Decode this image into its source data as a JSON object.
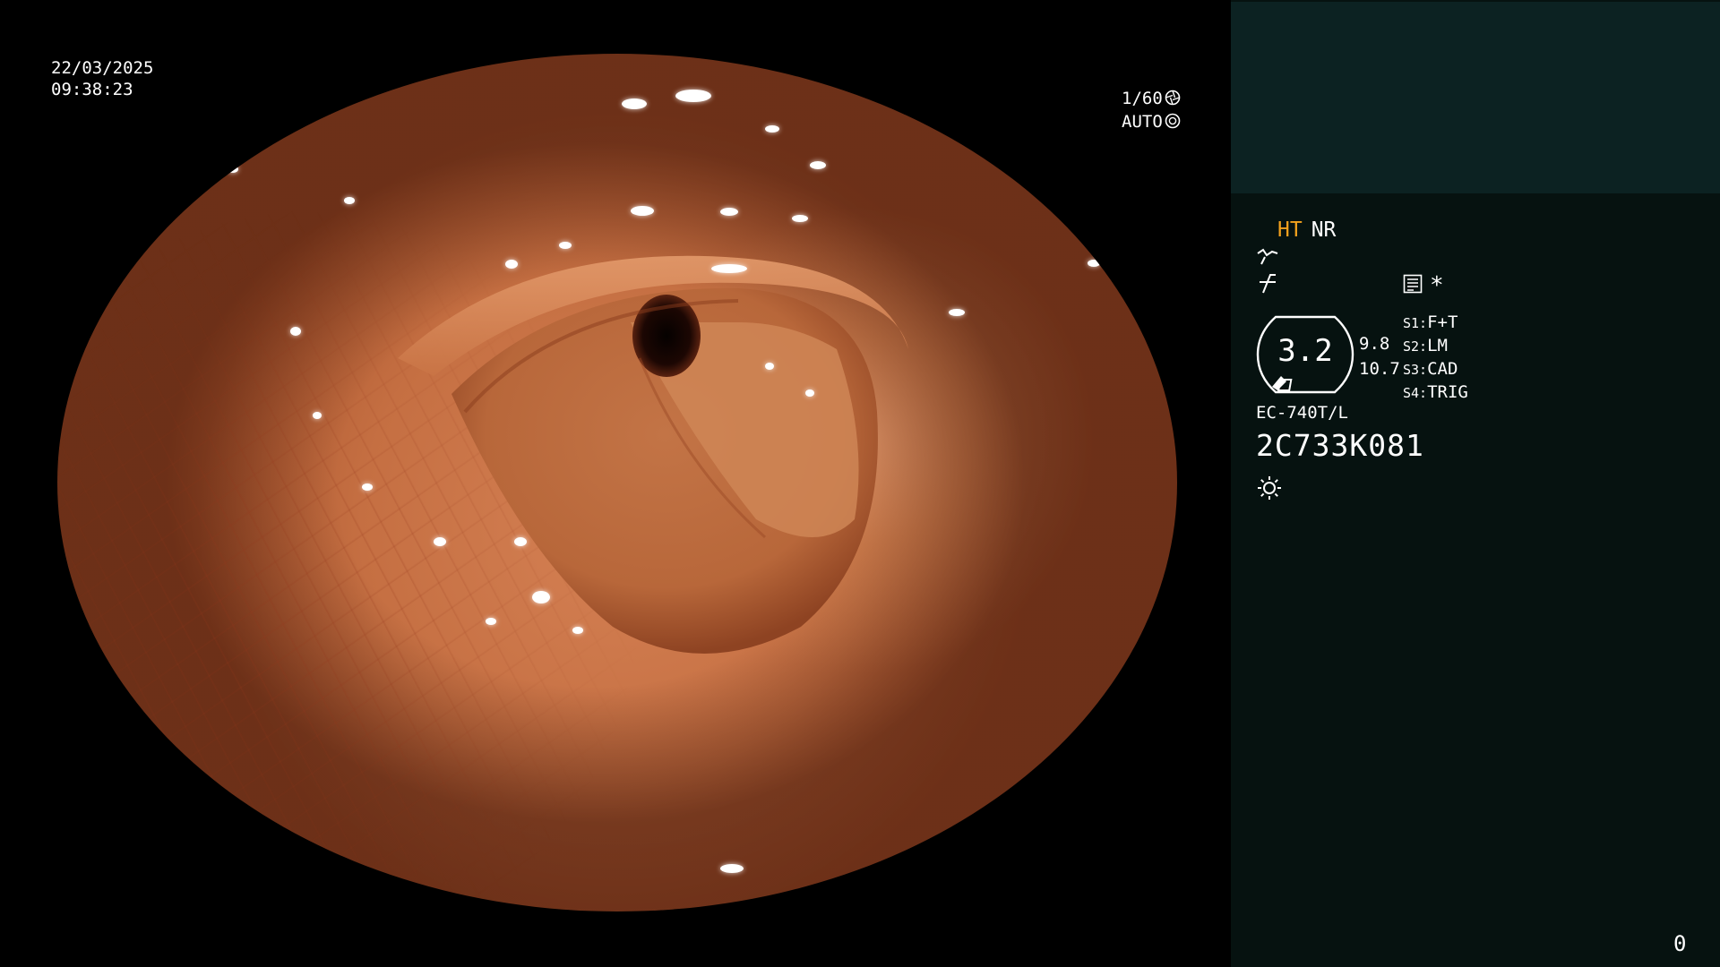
{
  "overlay": {
    "date": "22/03/2025",
    "time": "09:38:23",
    "shutter": "1/60",
    "exposure_mode": "AUTO",
    "shutter_icon": "aperture-icon",
    "exposure_icon": "iris-icon"
  },
  "info_panel": {
    "modes": {
      "ht": "HT",
      "nr": "NR"
    },
    "ht_color": "#f2a11d",
    "enhance_icon": "enhance-curve-icon",
    "structure_icon": "structure-icon",
    "menu_icon": "menu-list-icon",
    "star_mark": "*",
    "zoom": {
      "value": "3.2",
      "side_values": [
        "9.8",
        "10.7"
      ]
    },
    "switches": [
      {
        "key": "S1:",
        "value": "F+T"
      },
      {
        "key": "S2:",
        "value": "LM"
      },
      {
        "key": "S3:",
        "value": "CAD"
      },
      {
        "key": "S4:",
        "value": "TRIG"
      }
    ],
    "scope_model": "EC-740T/L",
    "scope_serial": "2C733K081",
    "light_icon": "sun-icon",
    "frame_counter": "0"
  },
  "colors": {
    "background": "#000000",
    "panel": "#061210",
    "panel_top_box": "#0c2222",
    "text": "#ffffff"
  }
}
